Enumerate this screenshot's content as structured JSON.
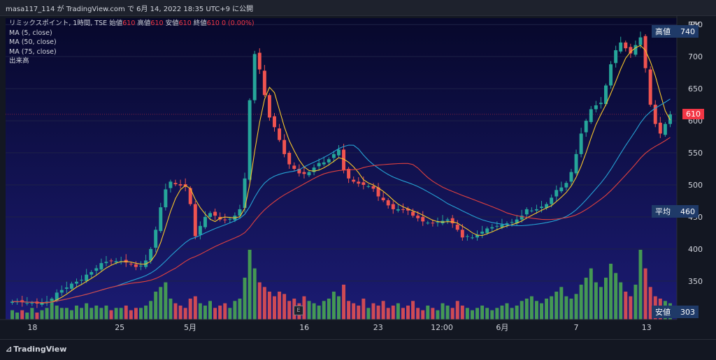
{
  "header": {
    "text": "masa117_114 が TradingView.com で 6月 14, 2022 18:35 UTC+9 に公開"
  },
  "legend": {
    "symbol_line": "リミックスポイント, 1時間, TSE",
    "open_label": "始値",
    "open": "610",
    "high_label": "高値",
    "high": "610",
    "low_label": "安値",
    "low": "610",
    "close_label": "終値",
    "close": "610",
    "change": "0 (0.00%)",
    "ma5": "MA (5, close)",
    "ma50": "MA (50, close)",
    "ma75": "MA (75, close)",
    "volume": "出来高"
  },
  "currency": "JPY",
  "footer": {
    "brand": "TradingView"
  },
  "colors": {
    "up": "#26a69a",
    "up_volume": "#4caf50",
    "down": "#ef5350",
    "ma5": "#f7c62a",
    "ma50": "#26a2d4",
    "ma75": "#e0413f",
    "plot_top": "#0a0c38",
    "plot_bottom": "#1a1a6b"
  },
  "markers": {
    "high": {
      "label": "高値",
      "value": 740
    },
    "current": {
      "value": 610
    },
    "avg": {
      "label": "平均",
      "value": 460
    },
    "low": {
      "label": "安値",
      "value": 303
    }
  },
  "chart_data": {
    "type": "candlestick",
    "ylim": [
      290,
      760
    ],
    "y_ticks": [
      350,
      400,
      450,
      500,
      550,
      600,
      650,
      700,
      750
    ],
    "x_ticks": [
      {
        "label": "18",
        "at": 0.04
      },
      {
        "label": "25",
        "at": 0.17
      },
      {
        "label": "5月",
        "at": 0.275
      },
      {
        "label": "16",
        "at": 0.445
      },
      {
        "label": "23",
        "at": 0.555
      },
      {
        "label": "12:00",
        "at": 0.65
      },
      {
        "label": "6月",
        "at": 0.74
      },
      {
        "label": "7",
        "at": 0.85
      },
      {
        "label": "13",
        "at": 0.955
      }
    ],
    "close_series": [
      318,
      318,
      317,
      316,
      316,
      315,
      316,
      318,
      322,
      332,
      336,
      340,
      346,
      349,
      352,
      360,
      364,
      370,
      378,
      380,
      381,
      381,
      381,
      379,
      376,
      372,
      374,
      382,
      400,
      430,
      465,
      493,
      505,
      501,
      499,
      497,
      470,
      420,
      436,
      450,
      456,
      452,
      446,
      445,
      447,
      452,
      462,
      510,
      632,
      704,
      680,
      640,
      605,
      590,
      570,
      548,
      532,
      525,
      518,
      517,
      520,
      527,
      534,
      535,
      540,
      548,
      555,
      523,
      510,
      505,
      502,
      500,
      498,
      494,
      482,
      476,
      468,
      462,
      462,
      461,
      460,
      452,
      448,
      443,
      441,
      440,
      442,
      444,
      446,
      440,
      430,
      418,
      420,
      418,
      422,
      427,
      432,
      434,
      436,
      438,
      440,
      442,
      446,
      452,
      462,
      460,
      462,
      466,
      470,
      480,
      492,
      496,
      503,
      520,
      548,
      580,
      600,
      618,
      624,
      628,
      655,
      688,
      710,
      722,
      713,
      705,
      718,
      730,
      682,
      625,
      595,
      580,
      595,
      610
    ],
    "volume": [
      4,
      3,
      4,
      3,
      5,
      3,
      4,
      5,
      9,
      6,
      5,
      5,
      4,
      6,
      5,
      7,
      5,
      6,
      5,
      6,
      4,
      5,
      5,
      6,
      4,
      5,
      5,
      6,
      8,
      12,
      14,
      16,
      9,
      7,
      6,
      5,
      9,
      10,
      7,
      6,
      8,
      5,
      6,
      7,
      5,
      8,
      9,
      18,
      30,
      22,
      16,
      14,
      12,
      10,
      12,
      11,
      8,
      9,
      7,
      10,
      8,
      7,
      6,
      8,
      9,
      12,
      10,
      15,
      8,
      7,
      6,
      9,
      5,
      7,
      6,
      8,
      5,
      6,
      7,
      5,
      6,
      8,
      5,
      4,
      6,
      5,
      4,
      7,
      6,
      5,
      8,
      6,
      5,
      4,
      5,
      6,
      5,
      4,
      5,
      6,
      7,
      5,
      6,
      8,
      9,
      10,
      8,
      7,
      9,
      10,
      12,
      14,
      10,
      9,
      11,
      15,
      18,
      22,
      16,
      14,
      18,
      24,
      20,
      16,
      12,
      10,
      15,
      30,
      22,
      14,
      10,
      9,
      8,
      7
    ],
    "ma5_close": 600,
    "ma50_close": 585,
    "ma75_close": 540,
    "avg_line": 460,
    "high_line": 740,
    "current_line": 610,
    "low_line": 303
  }
}
